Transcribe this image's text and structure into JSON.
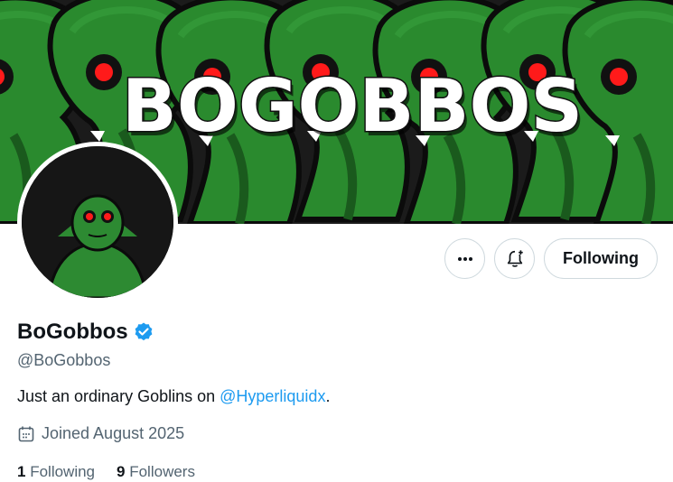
{
  "banner": {
    "title": "BOGOBBOS"
  },
  "profile": {
    "display_name": "BoGobbos",
    "handle": "@BoGobbos",
    "bio_text": "Just an ordinary Goblins on ",
    "bio_mention": "@Hyperliquidx",
    "bio_end": ".",
    "joined": "Joined August 2025",
    "verified": true
  },
  "actions": {
    "more_icon": "more-horizontal-icon",
    "notify_icon": "bell-plus-icon",
    "follow_label": "Following"
  },
  "stats": {
    "following_count": "1",
    "following_label": "Following",
    "followers_count": "9",
    "followers_label": "Followers"
  },
  "colors": {
    "link": "#1d9bf0",
    "verified": "#1d9bf0",
    "banner_green": "#1f6b22"
  }
}
